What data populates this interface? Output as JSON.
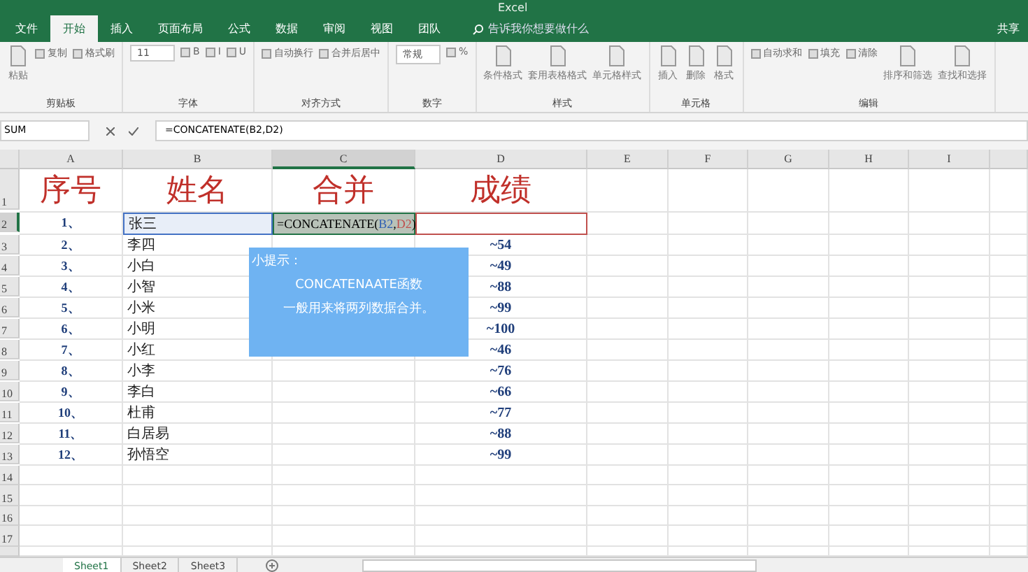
{
  "window": {
    "title": "Excel",
    "share": "共享"
  },
  "ribbon_tabs": [
    {
      "label": "文件",
      "selected": false
    },
    {
      "label": "开始",
      "selected": true
    },
    {
      "label": "插入",
      "selected": false
    },
    {
      "label": "页面布局",
      "selected": false
    },
    {
      "label": "公式",
      "selected": false
    },
    {
      "label": "数据",
      "selected": false
    },
    {
      "label": "审阅",
      "selected": false
    },
    {
      "label": "视图",
      "selected": false
    },
    {
      "label": "团队",
      "selected": false
    }
  ],
  "tell_me": {
    "placeholder": "告诉我你想要做什么"
  },
  "ribbon_groups": [
    {
      "label": "剪贴板",
      "items": [
        {
          "label": "粘贴",
          "kind": "large"
        },
        {
          "label": "复制",
          "kind": "small"
        },
        {
          "label": "格式刷",
          "kind": "small"
        }
      ]
    },
    {
      "label": "字体",
      "items": [
        {
          "label": "11",
          "kind": "field"
        },
        {
          "label": "B",
          "kind": "small"
        },
        {
          "label": "I",
          "kind": "small"
        },
        {
          "label": "U",
          "kind": "small"
        }
      ]
    },
    {
      "label": "对齐方式",
      "items": [
        {
          "label": "自动换行",
          "kind": "small"
        },
        {
          "label": "合并后居中",
          "kind": "small"
        }
      ]
    },
    {
      "label": "数字",
      "items": [
        {
          "label": "常规",
          "kind": "field"
        },
        {
          "label": "%",
          "kind": "small"
        }
      ]
    },
    {
      "label": "样式",
      "items": [
        {
          "label": "条件格式",
          "kind": "large"
        },
        {
          "label": "套用表格格式",
          "kind": "large"
        },
        {
          "label": "单元格样式",
          "kind": "large"
        }
      ]
    },
    {
      "label": "单元格",
      "items": [
        {
          "label": "插入",
          "kind": "large"
        },
        {
          "label": "删除",
          "kind": "large"
        },
        {
          "label": "格式",
          "kind": "large"
        }
      ]
    },
    {
      "label": "编辑",
      "items": [
        {
          "label": "自动求和",
          "kind": "small"
        },
        {
          "label": "填充",
          "kind": "small"
        },
        {
          "label": "清除",
          "kind": "small"
        },
        {
          "label": "排序和筛选",
          "kind": "large"
        },
        {
          "label": "查找和选择",
          "kind": "large"
        }
      ]
    }
  ],
  "formula_bar": {
    "name_box": "SUM",
    "formula": "=CONCATENATE(B2,D2)"
  },
  "columns": [
    {
      "label": "A",
      "selected": false
    },
    {
      "label": "B",
      "selected": false
    },
    {
      "label": "C",
      "selected": true
    },
    {
      "label": "D",
      "selected": false
    },
    {
      "label": "E",
      "selected": false
    },
    {
      "label": "F",
      "selected": false
    },
    {
      "label": "G",
      "selected": false
    },
    {
      "label": "H",
      "selected": false
    },
    {
      "label": "I",
      "selected": false
    }
  ],
  "rows": [
    {
      "number": "1",
      "kind": "title",
      "selected": false,
      "seq": "序号",
      "name": "姓名",
      "merge": "合并",
      "score": "成绩"
    },
    {
      "number": "2",
      "kind": "editing",
      "selected": true,
      "seq": "1、",
      "name": "张三",
      "formula_parts": [
        {
          "text": "=CONCATENATE("
        },
        {
          "text": "B2",
          "color": "#2f5fb3"
        },
        {
          "text": ","
        },
        {
          "text": "D2",
          "color": "#c0504d"
        },
        {
          "text": ")"
        }
      ]
    },
    {
      "number": "3",
      "kind": "data",
      "selected": false,
      "seq": "2、",
      "name": "李四",
      "score": "~54"
    },
    {
      "number": "4",
      "kind": "data",
      "selected": false,
      "seq": "3、",
      "name": "小白",
      "score": "~49"
    },
    {
      "number": "5",
      "kind": "data",
      "selected": false,
      "seq": "4、",
      "name": "小智",
      "score": "~88"
    },
    {
      "number": "6",
      "kind": "data",
      "selected": false,
      "seq": "5、",
      "name": "小米",
      "score": "~99"
    },
    {
      "number": "7",
      "kind": "data",
      "selected": false,
      "seq": "6、",
      "name": "小明",
      "score": "~100"
    },
    {
      "number": "8",
      "kind": "data",
      "selected": false,
      "seq": "7、",
      "name": "小红",
      "score": "~46"
    },
    {
      "number": "9",
      "kind": "data",
      "selected": false,
      "seq": "8、",
      "name": "小李",
      "score": "~76"
    },
    {
      "number": "10",
      "kind": "data",
      "selected": false,
      "seq": "9、",
      "name": "李白",
      "score": "~66"
    },
    {
      "number": "11",
      "kind": "data",
      "selected": false,
      "seq": "10、",
      "name": "杜甫",
      "score": "~77"
    },
    {
      "number": "12",
      "kind": "data",
      "selected": false,
      "seq": "11、",
      "name": "白居易",
      "score": "~88"
    },
    {
      "number": "13",
      "kind": "data",
      "selected": false,
      "seq": "12、",
      "name": "孙悟空",
      "score": "~99"
    },
    {
      "number": "14",
      "kind": "empty",
      "selected": false
    },
    {
      "number": "15",
      "kind": "empty",
      "selected": false
    },
    {
      "number": "16",
      "kind": "empty",
      "selected": false
    },
    {
      "number": "17",
      "kind": "empty",
      "selected": false
    }
  ],
  "tip": {
    "title": "小提示：",
    "lines": [
      "CONCATENAATE函数",
      "一般用来将两列数据合并。"
    ]
  },
  "sheet_tabs": [
    {
      "label": "Sheet1",
      "selected": true
    },
    {
      "label": "Sheet2",
      "selected": false
    },
    {
      "label": "Sheet3",
      "selected": false
    }
  ]
}
